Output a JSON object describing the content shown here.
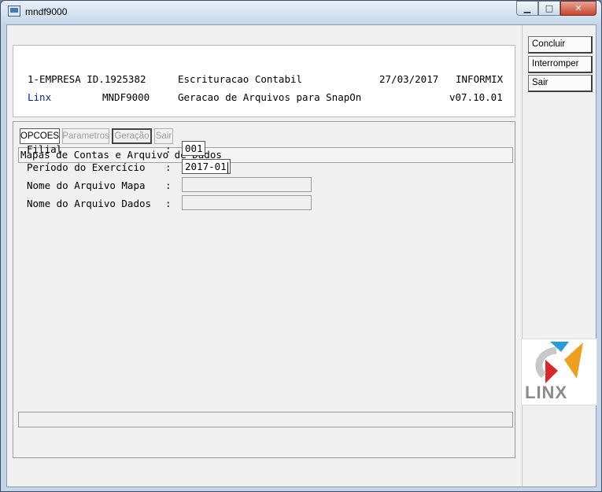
{
  "window": {
    "title": "mndf9000"
  },
  "header": {
    "line1": {
      "company": "1-EMPRESA ID.1925382",
      "module": "Escrituracao Contabil",
      "date": "27/03/2017",
      "db": "INFORMIX"
    },
    "line2": {
      "brand": "Linx",
      "program": "MNDF9000",
      "description": "Geracao de Arquivos para SnapOn",
      "version": "v07.10.01"
    }
  },
  "tabs": [
    {
      "label": "OPCOES"
    },
    {
      "label": "Parametros"
    },
    {
      "label": "Geração"
    },
    {
      "label": "Sair"
    }
  ],
  "section": {
    "title": "Mapas de Contas e Arquivo de Dados"
  },
  "fields": [
    {
      "label": "Filial",
      "colon": ":",
      "value": "001"
    },
    {
      "label": "Período do Exercício",
      "colon": ":",
      "value": "2017-01"
    },
    {
      "label": "Nome do Arquivo Mapa",
      "colon": ":",
      "value": ""
    },
    {
      "label": "Nome do Arquivo Dados",
      "colon": ":",
      "value": ""
    }
  ],
  "actions": {
    "concluir": "Concluir",
    "interromper": "Interromper",
    "sair": "Sair"
  },
  "logo": {
    "text": "LINX"
  },
  "colors": {
    "brand_blue": "#0b1e8c",
    "logo_orange": "#f0a020",
    "logo_blue": "#2a9ad8",
    "logo_red": "#d8282a"
  }
}
